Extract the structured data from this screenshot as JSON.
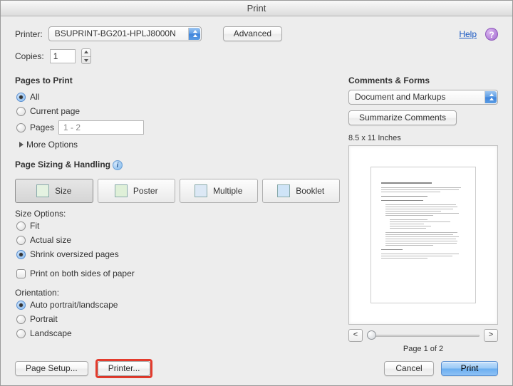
{
  "window": {
    "title": "Print"
  },
  "header": {
    "printer_label": "Printer:",
    "printer_value": "BSUPRINT-BG201-HPLJ8000N",
    "advanced": "Advanced",
    "help": "Help",
    "copies_label": "Copies:",
    "copies_value": "1"
  },
  "pages_to_print": {
    "title": "Pages to Print",
    "all": "All",
    "current": "Current page",
    "pages": "Pages",
    "range_placeholder": "1 - 2",
    "more_options": "More Options"
  },
  "sizing": {
    "title": "Page Sizing & Handling",
    "size": "Size",
    "poster": "Poster",
    "multiple": "Multiple",
    "booklet": "Booklet",
    "options_label": "Size Options:",
    "fit": "Fit",
    "actual": "Actual size",
    "shrink": "Shrink oversized pages",
    "duplex": "Print on both sides of paper"
  },
  "orientation": {
    "title": "Orientation:",
    "auto": "Auto portrait/landscape",
    "portrait": "Portrait",
    "landscape": "Landscape"
  },
  "comments": {
    "title": "Comments & Forms",
    "mode": "Document and Markups",
    "summarize": "Summarize Comments"
  },
  "preview": {
    "dimensions": "8.5 x 11 Inches",
    "page_indicator": "Page 1 of 2",
    "prev": "<",
    "next": ">"
  },
  "footer": {
    "page_setup": "Page Setup...",
    "printer_btn": "Printer...",
    "cancel": "Cancel",
    "print": "Print"
  }
}
